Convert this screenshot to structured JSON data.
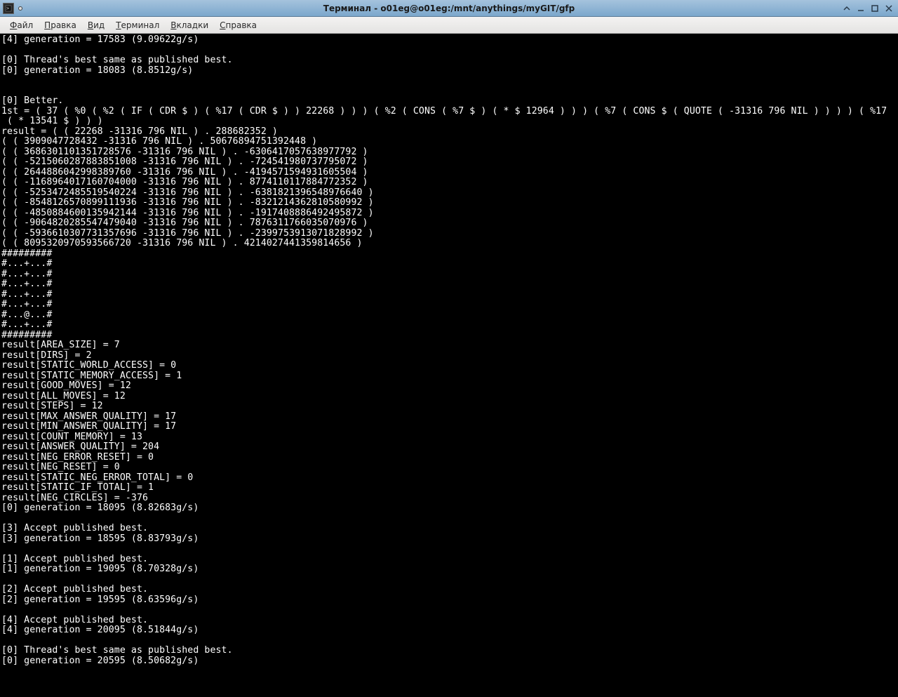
{
  "window": {
    "title": "Терминал - o01eg@o01eg:/mnt/anythings/myGIT/gfp"
  },
  "menu": {
    "file": "Файл",
    "edit": "Правка",
    "view": "Вид",
    "terminal": "Терминал",
    "tabs": "Вкладки",
    "help": "Справка"
  },
  "terminal": {
    "lines": [
      "[4] generation = 17583 (9.09622g/s)",
      "",
      "[0] Thread's best same as published best.",
      "[0] generation = 18083 (8.8512g/s)",
      "",
      "",
      "[0] Better.",
      "1st = ( 37 ( %0 ( %2 ( IF ( CDR $ ) ( %17 ( CDR $ ) ) 22268 ) ) ) ( %2 ( CONS ( %7 $ ) ( * $ 12964 ) ) ) ( %7 ( CONS $ ( QUOTE ( -31316 796 NIL ) ) ) ) ( %17",
      " ( * 13541 $ ) ) )",
      "result = ( ( 22268 -31316 796 NIL ) . 288682352 )",
      "( ( 3909047728432 -31316 796 NIL ) . 50676894751392448 )",
      "( ( 3686301101351728576 -31316 796 NIL ) . -6306417057638977792 )",
      "( ( -5215060287883851008 -31316 796 NIL ) . -724541980737795072 )",
      "( ( 2644886042998389760 -31316 796 NIL ) . -4194571594931605504 )",
      "( ( -1168964017160704000 -31316 796 NIL ) . 8774110117884772352 )",
      "( ( -5253472485519540224 -31316 796 NIL ) . -6381821396548976640 )",
      "( ( -8548126570899111936 -31316 796 NIL ) . -8321214362810580992 )",
      "( ( -4850884600135942144 -31316 796 NIL ) . -1917408886492495872 )",
      "( ( -9064820285547479040 -31316 796 NIL ) . 7876311766035070976 )",
      "( ( -5936610307731357696 -31316 796 NIL ) . -2399753913071828992 )",
      "( ( 8095320970593566720 -31316 796 NIL ) . 4214027441359814656 )",
      "#########",
      "#...+...#",
      "#...+...#",
      "#...+...#",
      "#...+...#",
      "#...+...#",
      "#...@...#",
      "#...+...#",
      "#########",
      "result[AREA_SIZE] = 7",
      "result[DIRS] = 2",
      "result[STATIC_WORLD_ACCESS] = 0",
      "result[STATIC_MEMORY_ACCESS] = 1",
      "result[GOOD_MOVES] = 12",
      "result[ALL_MOVES] = 12",
      "result[STEPS] = 12",
      "result[MAX_ANSWER_QUALITY] = 17",
      "result[MIN_ANSWER_QUALITY] = 17",
      "result[COUNT_MEMORY] = 13",
      "result[ANSWER_QUALITY] = 204",
      "result[NEG_ERROR_RESET] = 0",
      "result[NEG_RESET] = 0",
      "result[STATIC_NEG_ERROR_TOTAL] = 0",
      "result[STATIC_IF_TOTAL] = 1",
      "result[NEG_CIRCLES] = -376",
      "[0] generation = 18095 (8.82683g/s)",
      "",
      "[3] Accept published best.",
      "[3] generation = 18595 (8.83793g/s)",
      "",
      "[1] Accept published best.",
      "[1] generation = 19095 (8.70328g/s)",
      "",
      "[2] Accept published best.",
      "[2] generation = 19595 (8.63596g/s)",
      "",
      "[4] Accept published best.",
      "[4] generation = 20095 (8.51844g/s)",
      "",
      "[0] Thread's best same as published best.",
      "[0] generation = 20595 (8.50682g/s)"
    ]
  }
}
